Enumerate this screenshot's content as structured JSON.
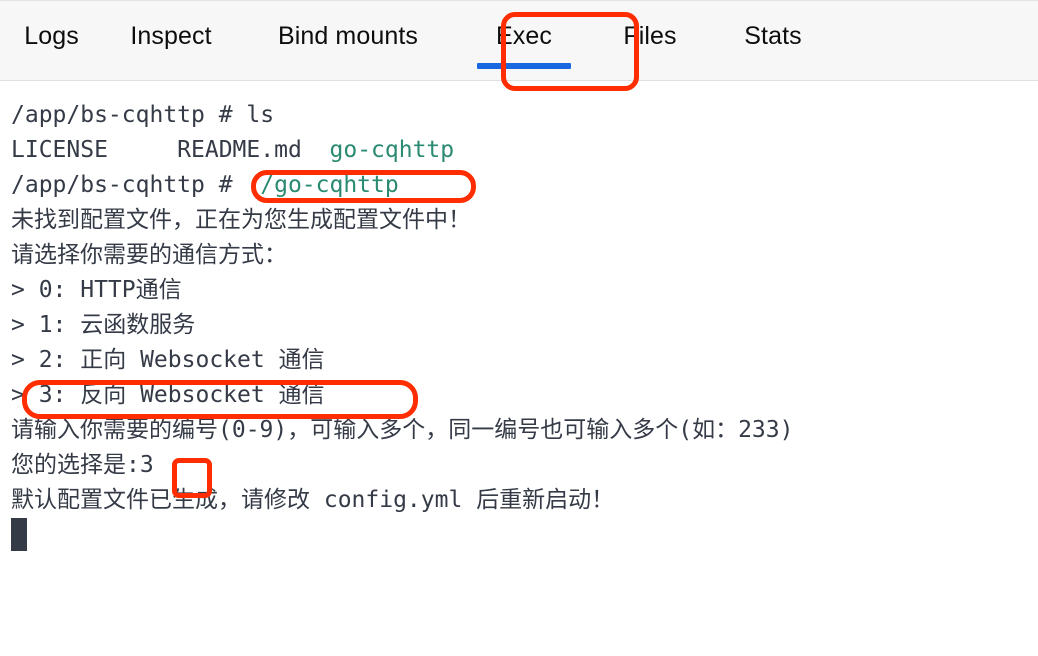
{
  "window": {
    "app": "Docker container detail view",
    "active_tab": "Exec"
  },
  "tabbar": {
    "tabs": [
      {
        "label": "Logs",
        "active": false
      },
      {
        "label": "Inspect",
        "active": false
      },
      {
        "label": "Bind mounts",
        "active": false
      },
      {
        "label": "Exec",
        "active": true
      },
      {
        "label": "Files",
        "active": false
      },
      {
        "label": "Stats",
        "active": false
      }
    ],
    "active_underline_color": "#1968e0",
    "background_color": "#f7f7f7",
    "text_color": "#0d0d0d"
  },
  "terminal": {
    "background_color": "#ffffff",
    "text_color": "#343a46",
    "highlight_color": "#2a8a72",
    "cursor": "block",
    "lines": [
      {
        "id": "l1",
        "prompt": "/app/bs-cqhttp # ",
        "text": "ls"
      },
      {
        "id": "l2",
        "text": "LICENSE     README.md  ",
        "green": "go-cqhttp"
      },
      {
        "id": "l3",
        "prompt": "/app/bs-cqhttp # ",
        "green": "./go-cqhttp"
      },
      {
        "id": "l4",
        "text": "未找到配置文件，正在为您生成配置文件中！"
      },
      {
        "id": "l5",
        "text": "请选择你需要的通信方式："
      },
      {
        "id": "l6",
        "text": "> 0: HTTP通信"
      },
      {
        "id": "l7",
        "text": "> 1: 云函数服务"
      },
      {
        "id": "l8",
        "text": "> 2: 正向 Websocket 通信"
      },
      {
        "id": "l9",
        "text": "> 3: 反向 Websocket 通信"
      },
      {
        "id": "l10",
        "text": "请输入你需要的编号(0-9)，可输入多个，同一编号也可输入多个(如：233)"
      },
      {
        "id": "l11",
        "text": "您的选择是:3"
      },
      {
        "id": "l12",
        "text": "默认配置文件已生成，请修改 config.yml 后重新启动！"
      }
    ]
  },
  "annotations": {
    "color": "#ff2d00",
    "boxes": [
      {
        "name": "exec-tab-highlight",
        "target": "Exec tab"
      },
      {
        "name": "command-highlight",
        "target": "./go-cqhttp"
      },
      {
        "name": "option-3-highlight",
        "target": "> 3: 反向 Websocket 通信"
      },
      {
        "name": "choice-input-highlight",
        "target": "3"
      }
    ]
  }
}
